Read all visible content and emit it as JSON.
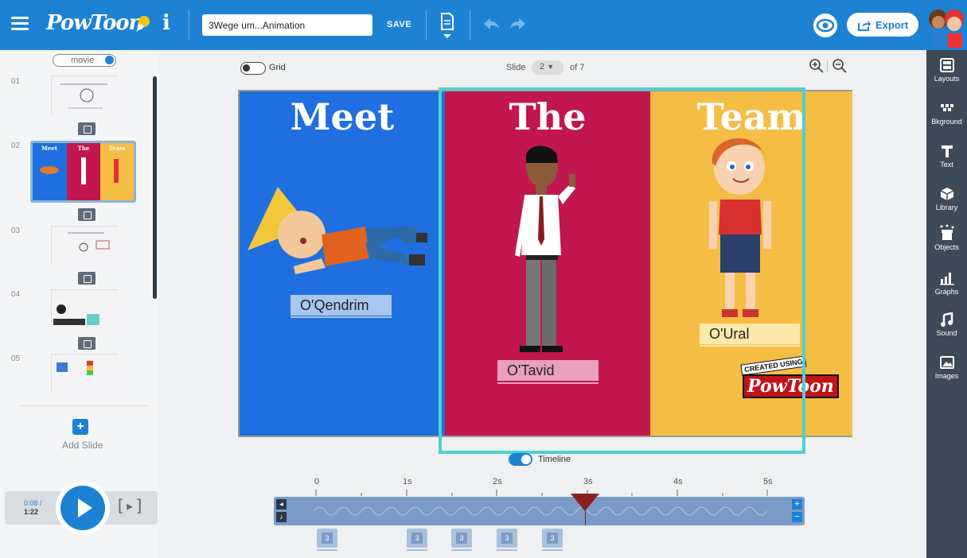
{
  "topbar": {
    "logo": "PowToon",
    "info_label": "i",
    "title": "3Wege um...Animation",
    "save_label": "SAVE",
    "export_label": "Export"
  },
  "sidebar_right": {
    "tools": [
      {
        "label": "Layouts",
        "icon": "layouts-icon"
      },
      {
        "label": "Bkground",
        "icon": "background-icon"
      },
      {
        "label": "Text",
        "icon": "text-icon"
      },
      {
        "label": "Library",
        "icon": "library-icon"
      },
      {
        "label": "Objects",
        "icon": "objects-icon"
      },
      {
        "label": "Graphs",
        "icon": "graphs-icon"
      },
      {
        "label": "Sound",
        "icon": "sound-icon"
      },
      {
        "label": "Images",
        "icon": "images-icon"
      }
    ]
  },
  "left_panel": {
    "mode_label": "movie",
    "slides": [
      "01",
      "02",
      "03",
      "04",
      "05"
    ],
    "add_slide_label": "Add Slide"
  },
  "player": {
    "current_time": "0:08 /",
    "total_time": "1:22"
  },
  "canvas_header": {
    "grid_label": "Grid",
    "slide_label": "Slide",
    "slide_current": "2",
    "slide_of": "of 7"
  },
  "stage": {
    "headings": [
      "Meet",
      "The",
      "Team"
    ],
    "names": [
      "O'Qendrim",
      "O'Tavid",
      "O'Ural"
    ],
    "badge_top": "CREATED USING",
    "badge_logo": "PowToon"
  },
  "timeline": {
    "label": "Timeline",
    "ticks": [
      "0",
      "1s",
      "2s",
      "3s",
      "4s",
      "5s"
    ],
    "markers": [
      "3",
      "3",
      "3",
      "3",
      "3"
    ]
  },
  "colors": {
    "brand_blue": "#1e82d4",
    "panel_blue": "#1f6fe0",
    "panel_red": "#c2164f",
    "panel_yellow": "#f5bd44",
    "selection": "#4ed1d0"
  }
}
